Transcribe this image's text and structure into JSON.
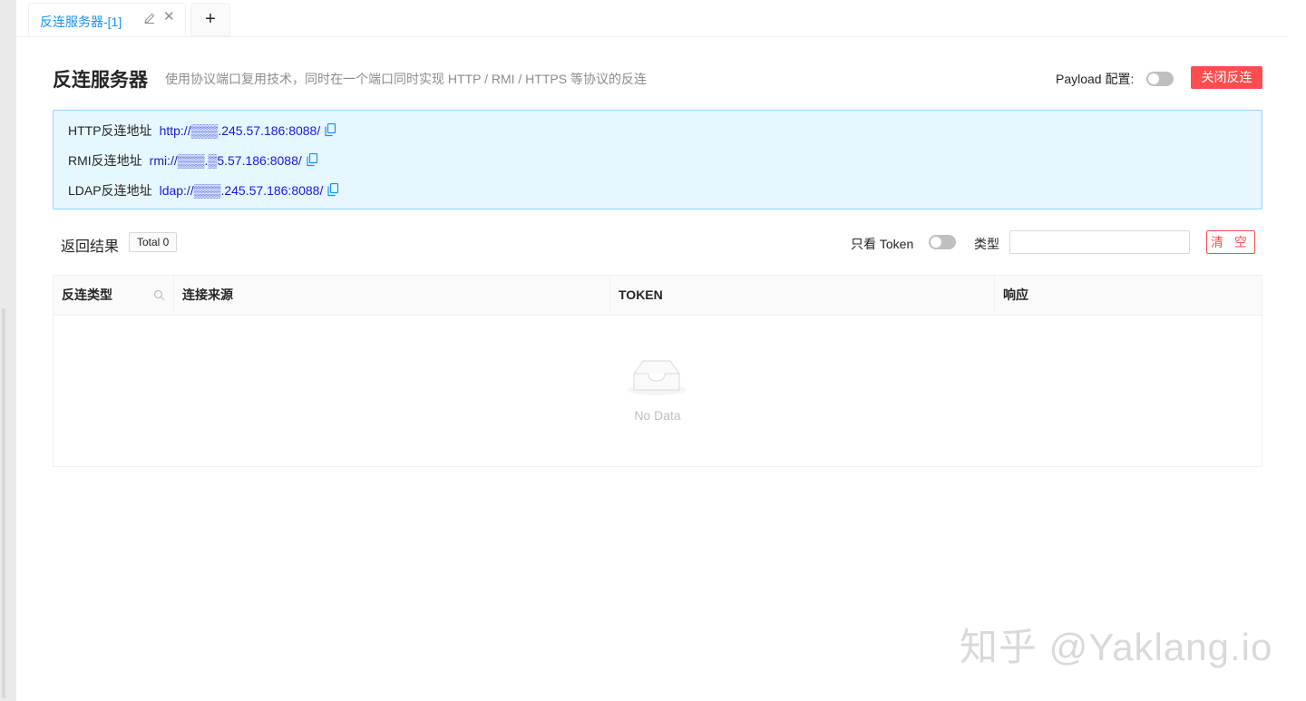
{
  "tabs": [
    {
      "label": "反连服务器-[1]"
    }
  ],
  "tab_add_label": "+",
  "tab_close_label": "✕",
  "header": {
    "title": "反连服务器",
    "description": "使用协议端口复用技术，同时在一个端口同时实现 HTTP / RMI / HTTPS 等协议的反连",
    "payload_label": "Payload 配置:",
    "close_button": "关闭反连"
  },
  "addresses": [
    {
      "label": "HTTP反连地址",
      "value": "http://▒▒▒.245.57.186:8088/"
    },
    {
      "label": "RMI反连地址",
      "value": "rmi://▒▒▒.▒5.57.186:8088/"
    },
    {
      "label": "LDAP反连地址",
      "value": "ldap://▒▒▒.245.57.186:8088/"
    }
  ],
  "results": {
    "title": "返回结果",
    "total": "Total 0",
    "token_only_label": "只看 Token",
    "type_label": "类型",
    "type_value": "",
    "clear_button": "清 空"
  },
  "table": {
    "columns": [
      "反连类型",
      "连接来源",
      "TOKEN",
      "响应"
    ],
    "rows": [],
    "empty_text": "No Data"
  },
  "watermark": "知乎 @Yaklang.io",
  "colors": {
    "primary": "#1890ff",
    "danger": "#ff4d4f",
    "info_bg": "#e6f7ff",
    "info_border": "#91d5ff",
    "link": "#1a1adb"
  },
  "icons": {
    "edit": "edit-icon",
    "close": "close-icon",
    "copy": "copy-icon",
    "search": "search-icon",
    "empty": "empty-inbox-icon"
  }
}
